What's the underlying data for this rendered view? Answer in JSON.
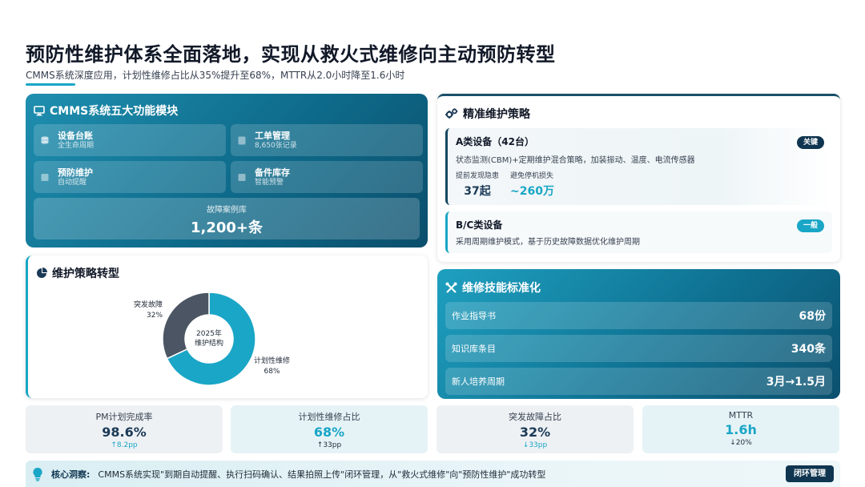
{
  "header": {
    "title": "预防性维护体系全面落地，实现从救火式维修向主动预防转型",
    "subtitle": "CMMS系统深度应用，计划性维修占比从35%提升至68%，MTTR从2.0小时降至1.6小时"
  },
  "modules_panel": {
    "title": "CMMS系统五大功能模块",
    "icon": "monitor-icon",
    "modules": [
      {
        "name": "设备台账",
        "sub": "全生命周期",
        "icon": "database-icon"
      },
      {
        "name": "工单管理",
        "sub": "8,650张记录",
        "icon": "clipboard-icon"
      },
      {
        "name": "预防维护",
        "sub": "自动提醒",
        "icon": "calendar-icon"
      },
      {
        "name": "备件库存",
        "sub": "智能预警",
        "icon": "box-icon"
      }
    ],
    "case_library": {
      "label": "故障案例库",
      "value": "1,200+条"
    }
  },
  "strategy_panel": {
    "title": "精准维护策略",
    "icon": "gears-icon",
    "class_a": {
      "title": "A类设备（42台）",
      "tag": "关键",
      "desc": "状态监测(CBM)+定期维护混合策略，加装振动、温度、电流传感器",
      "metrics": [
        {
          "label": "提前发现隐患",
          "value": "37起"
        },
        {
          "label": "避免停机损失",
          "value": "~260万"
        }
      ]
    },
    "class_bc": {
      "title": "B/C类设备",
      "tag": "一般",
      "desc": "采用周期维护模式，基于历史故障数据优化维护周期"
    }
  },
  "donut_panel": {
    "title": "维护策略转型",
    "icon": "pie-chart-icon",
    "center_line1": "2025年",
    "center_line2": "维护结构",
    "labels": [
      {
        "name": "突发故障",
        "pct": "32%"
      },
      {
        "name": "计划性维修",
        "pct": "68%"
      }
    ]
  },
  "chart_data": {
    "type": "pie",
    "categories": [
      "计划性维修",
      "突发故障"
    ],
    "values": [
      68,
      32
    ],
    "colors": [
      "#1aa6c6",
      "#4b5563"
    ]
  },
  "standards_panel": {
    "title": "维修技能标准化",
    "icon": "tools-icon",
    "rows": [
      {
        "label": "作业指导书",
        "value": "68份"
      },
      {
        "label": "知识库条目",
        "value": "340条"
      },
      {
        "label": "新人培养周期",
        "value": "3月→1.5月"
      }
    ]
  },
  "kpis": [
    {
      "label": "PM计划完成率",
      "value": "98.6%",
      "delta": "↑8.2pp",
      "value_color": "#1b3a57",
      "delta_color": "#1aa6c6"
    },
    {
      "label": "计划性维修占比",
      "value": "68%",
      "delta": "↑33pp",
      "value_color": "#1aa6c6",
      "delta_color": "#1f2a37"
    },
    {
      "label": "突发故障占比",
      "value": "32%",
      "delta": "↓33pp",
      "value_color": "#1b3a57",
      "delta_color": "#1aa6c6"
    },
    {
      "label": "MTTR",
      "value": "1.6h",
      "delta": "↓20%",
      "value_color": "#1aa6c6",
      "delta_color": "#1f2a37"
    }
  ],
  "insight": {
    "icon": "lightbulb-icon",
    "label": "核心洞察:",
    "text": "CMMS系统实现\"到期自动提醒、执行扫码确认、结果拍照上传\"闭环管理，从\"救火式维修\"向\"预防性维护\"成功转型",
    "button": "闭环管理"
  }
}
